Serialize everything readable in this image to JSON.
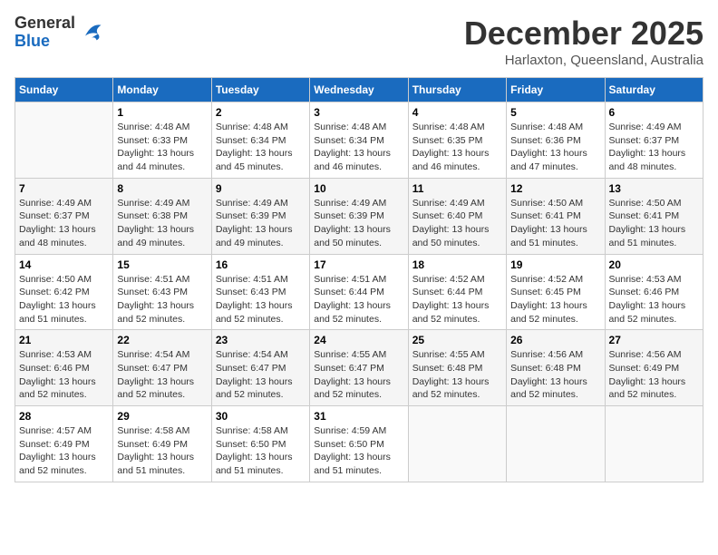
{
  "logo": {
    "general": "General",
    "blue": "Blue"
  },
  "title": "December 2025",
  "location": "Harlaxton, Queensland, Australia",
  "days_header": [
    "Sunday",
    "Monday",
    "Tuesday",
    "Wednesday",
    "Thursday",
    "Friday",
    "Saturday"
  ],
  "weeks": [
    [
      {
        "day": "",
        "sunrise": "",
        "sunset": "",
        "daylight": ""
      },
      {
        "day": "1",
        "sunrise": "Sunrise: 4:48 AM",
        "sunset": "Sunset: 6:33 PM",
        "daylight": "Daylight: 13 hours and 44 minutes."
      },
      {
        "day": "2",
        "sunrise": "Sunrise: 4:48 AM",
        "sunset": "Sunset: 6:34 PM",
        "daylight": "Daylight: 13 hours and 45 minutes."
      },
      {
        "day": "3",
        "sunrise": "Sunrise: 4:48 AM",
        "sunset": "Sunset: 6:34 PM",
        "daylight": "Daylight: 13 hours and 46 minutes."
      },
      {
        "day": "4",
        "sunrise": "Sunrise: 4:48 AM",
        "sunset": "Sunset: 6:35 PM",
        "daylight": "Daylight: 13 hours and 46 minutes."
      },
      {
        "day": "5",
        "sunrise": "Sunrise: 4:48 AM",
        "sunset": "Sunset: 6:36 PM",
        "daylight": "Daylight: 13 hours and 47 minutes."
      },
      {
        "day": "6",
        "sunrise": "Sunrise: 4:49 AM",
        "sunset": "Sunset: 6:37 PM",
        "daylight": "Daylight: 13 hours and 48 minutes."
      }
    ],
    [
      {
        "day": "7",
        "sunrise": "Sunrise: 4:49 AM",
        "sunset": "Sunset: 6:37 PM",
        "daylight": "Daylight: 13 hours and 48 minutes."
      },
      {
        "day": "8",
        "sunrise": "Sunrise: 4:49 AM",
        "sunset": "Sunset: 6:38 PM",
        "daylight": "Daylight: 13 hours and 49 minutes."
      },
      {
        "day": "9",
        "sunrise": "Sunrise: 4:49 AM",
        "sunset": "Sunset: 6:39 PM",
        "daylight": "Daylight: 13 hours and 49 minutes."
      },
      {
        "day": "10",
        "sunrise": "Sunrise: 4:49 AM",
        "sunset": "Sunset: 6:39 PM",
        "daylight": "Daylight: 13 hours and 50 minutes."
      },
      {
        "day": "11",
        "sunrise": "Sunrise: 4:49 AM",
        "sunset": "Sunset: 6:40 PM",
        "daylight": "Daylight: 13 hours and 50 minutes."
      },
      {
        "day": "12",
        "sunrise": "Sunrise: 4:50 AM",
        "sunset": "Sunset: 6:41 PM",
        "daylight": "Daylight: 13 hours and 51 minutes."
      },
      {
        "day": "13",
        "sunrise": "Sunrise: 4:50 AM",
        "sunset": "Sunset: 6:41 PM",
        "daylight": "Daylight: 13 hours and 51 minutes."
      }
    ],
    [
      {
        "day": "14",
        "sunrise": "Sunrise: 4:50 AM",
        "sunset": "Sunset: 6:42 PM",
        "daylight": "Daylight: 13 hours and 51 minutes."
      },
      {
        "day": "15",
        "sunrise": "Sunrise: 4:51 AM",
        "sunset": "Sunset: 6:43 PM",
        "daylight": "Daylight: 13 hours and 52 minutes."
      },
      {
        "day": "16",
        "sunrise": "Sunrise: 4:51 AM",
        "sunset": "Sunset: 6:43 PM",
        "daylight": "Daylight: 13 hours and 52 minutes."
      },
      {
        "day": "17",
        "sunrise": "Sunrise: 4:51 AM",
        "sunset": "Sunset: 6:44 PM",
        "daylight": "Daylight: 13 hours and 52 minutes."
      },
      {
        "day": "18",
        "sunrise": "Sunrise: 4:52 AM",
        "sunset": "Sunset: 6:44 PM",
        "daylight": "Daylight: 13 hours and 52 minutes."
      },
      {
        "day": "19",
        "sunrise": "Sunrise: 4:52 AM",
        "sunset": "Sunset: 6:45 PM",
        "daylight": "Daylight: 13 hours and 52 minutes."
      },
      {
        "day": "20",
        "sunrise": "Sunrise: 4:53 AM",
        "sunset": "Sunset: 6:46 PM",
        "daylight": "Daylight: 13 hours and 52 minutes."
      }
    ],
    [
      {
        "day": "21",
        "sunrise": "Sunrise: 4:53 AM",
        "sunset": "Sunset: 6:46 PM",
        "daylight": "Daylight: 13 hours and 52 minutes."
      },
      {
        "day": "22",
        "sunrise": "Sunrise: 4:54 AM",
        "sunset": "Sunset: 6:47 PM",
        "daylight": "Daylight: 13 hours and 52 minutes."
      },
      {
        "day": "23",
        "sunrise": "Sunrise: 4:54 AM",
        "sunset": "Sunset: 6:47 PM",
        "daylight": "Daylight: 13 hours and 52 minutes."
      },
      {
        "day": "24",
        "sunrise": "Sunrise: 4:55 AM",
        "sunset": "Sunset: 6:47 PM",
        "daylight": "Daylight: 13 hours and 52 minutes."
      },
      {
        "day": "25",
        "sunrise": "Sunrise: 4:55 AM",
        "sunset": "Sunset: 6:48 PM",
        "daylight": "Daylight: 13 hours and 52 minutes."
      },
      {
        "day": "26",
        "sunrise": "Sunrise: 4:56 AM",
        "sunset": "Sunset: 6:48 PM",
        "daylight": "Daylight: 13 hours and 52 minutes."
      },
      {
        "day": "27",
        "sunrise": "Sunrise: 4:56 AM",
        "sunset": "Sunset: 6:49 PM",
        "daylight": "Daylight: 13 hours and 52 minutes."
      }
    ],
    [
      {
        "day": "28",
        "sunrise": "Sunrise: 4:57 AM",
        "sunset": "Sunset: 6:49 PM",
        "daylight": "Daylight: 13 hours and 52 minutes."
      },
      {
        "day": "29",
        "sunrise": "Sunrise: 4:58 AM",
        "sunset": "Sunset: 6:49 PM",
        "daylight": "Daylight: 13 hours and 51 minutes."
      },
      {
        "day": "30",
        "sunrise": "Sunrise: 4:58 AM",
        "sunset": "Sunset: 6:50 PM",
        "daylight": "Daylight: 13 hours and 51 minutes."
      },
      {
        "day": "31",
        "sunrise": "Sunrise: 4:59 AM",
        "sunset": "Sunset: 6:50 PM",
        "daylight": "Daylight: 13 hours and 51 minutes."
      },
      {
        "day": "",
        "sunrise": "",
        "sunset": "",
        "daylight": ""
      },
      {
        "day": "",
        "sunrise": "",
        "sunset": "",
        "daylight": ""
      },
      {
        "day": "",
        "sunrise": "",
        "sunset": "",
        "daylight": ""
      }
    ]
  ]
}
